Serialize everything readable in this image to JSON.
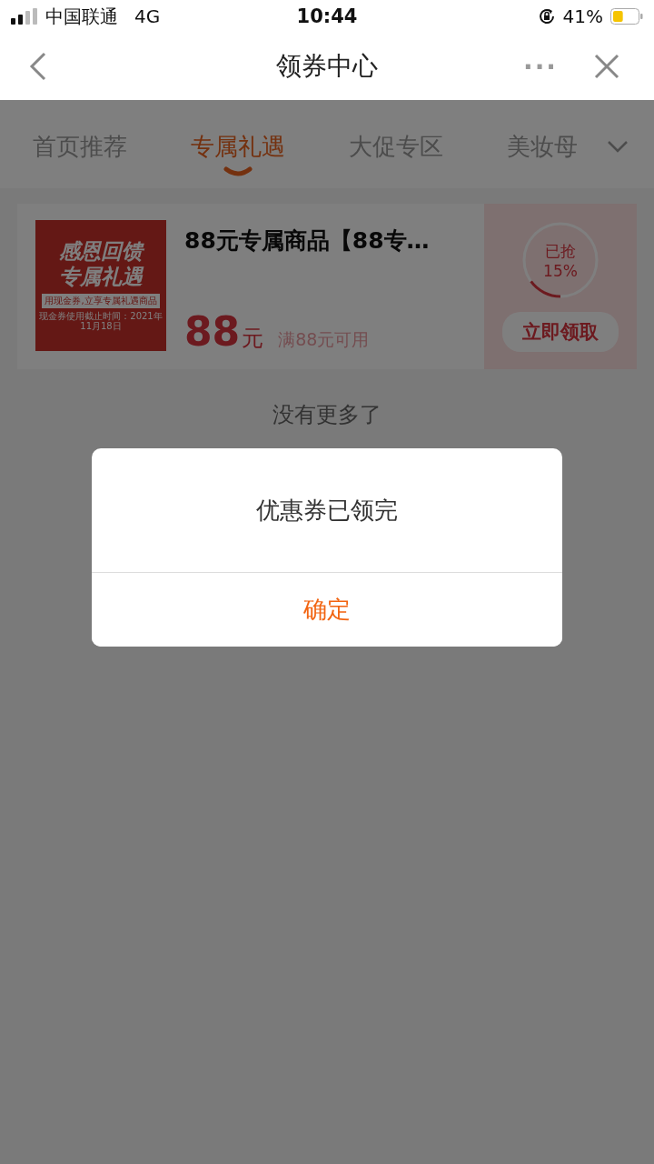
{
  "status_bar": {
    "carrier": "中国联通",
    "network": "4G",
    "time": "10:44",
    "battery_percent": "41%",
    "battery": {
      "level": 0.41
    }
  },
  "nav": {
    "title": "领券中心",
    "more": "···"
  },
  "tabs": [
    {
      "label": "首页推荐",
      "selected": false
    },
    {
      "label": "专属礼遇",
      "selected": true
    },
    {
      "label": "大促专区",
      "selected": false
    },
    {
      "label": "美妆母",
      "selected": false
    }
  ],
  "coupon": {
    "banner": {
      "line_1": "感恩回馈",
      "line_2": "专属礼遇",
      "ribbon": "用现金券,立享专属礼遇商品",
      "note": "现金券使用截止时间：2021年11月18日"
    },
    "title": "88元专属商品【88专…",
    "amount": "88",
    "unit": "元",
    "condition": "满88元可用",
    "claimed_label": "已抢",
    "claimed_percent": "15%",
    "claimed": {
      "level": 0.15
    },
    "button": "立即领取"
  },
  "end_text": "没有更多了",
  "dialog": {
    "message": "优惠券已领完",
    "button": "确定"
  }
}
